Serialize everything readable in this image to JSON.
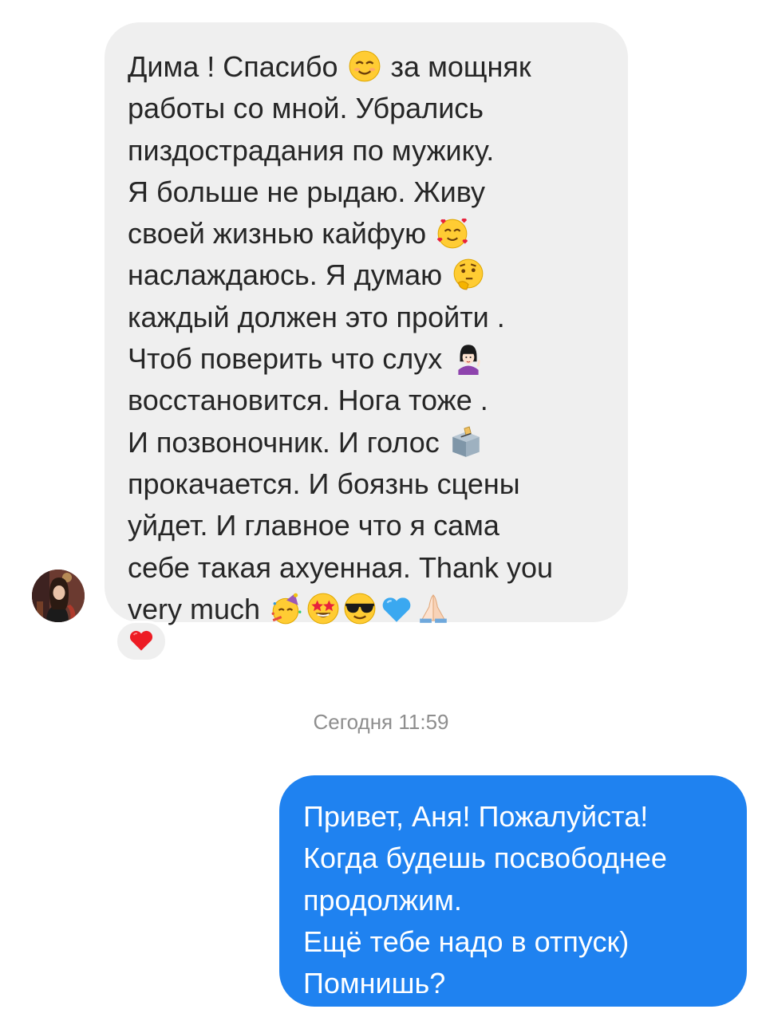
{
  "incoming_message": {
    "lines": [
      {
        "pre": "Дима ! Спасибо ",
        "emoji": "smiling-face-icon",
        "post": " за мощняк"
      },
      {
        "pre": "работы со мной. Убрались",
        "emoji": "",
        "post": ""
      },
      {
        "pre": "пиздострадания по мужику.",
        "emoji": "",
        "post": ""
      },
      {
        "pre": "Я больше не рыдаю. Живу",
        "emoji": "",
        "post": ""
      },
      {
        "pre": "своей жизнью кайфую ",
        "emoji": "smiling-face-with-hearts-icon",
        "post": ""
      },
      {
        "pre": "наслаждаюсь. Я думаю ",
        "emoji": "thinking-face-icon",
        "post": ""
      },
      {
        "pre": "каждый должен это пройти .",
        "emoji": "",
        "post": ""
      },
      {
        "pre": "Чтоб поверить что слух ",
        "emoji": "woman-tipping-hand-icon",
        "post": ""
      },
      {
        "pre": "восстановится. Нога тоже .",
        "emoji": "",
        "post": ""
      },
      {
        "pre": "И позвоночник. И голос ",
        "emoji": "ballot-box-icon",
        "post": ""
      },
      {
        "pre": "прокачается. И боязнь сцены",
        "emoji": "",
        "post": ""
      },
      {
        "pre": "уйдет. И главное что я сама",
        "emoji": "",
        "post": ""
      },
      {
        "pre": "себе такая ахуенная. Thank you",
        "emoji": "",
        "post": ""
      },
      {
        "pre": "very much ",
        "emoji": "",
        "post": ""
      }
    ],
    "last_line_emojis": [
      "partying-face-icon",
      "star-struck-icon",
      "smiling-face-with-sunglasses-icon",
      "blue-heart-icon",
      "folded-hands-icon"
    ]
  },
  "reaction": {
    "emoji": "red-heart-icon",
    "color": "#ed1c24"
  },
  "timestamp": "Сегодня 11:59",
  "outgoing_message": {
    "lines": [
      "Привет, Аня! Пожалуйста!",
      "Когда будешь посвободнее",
      "продолжим.",
      "Ещё тебе надо в отпуск)",
      "Помнишь?"
    ]
  },
  "colors": {
    "incoming_bubble": "#efefef",
    "outgoing_bubble": "#1f82f0",
    "incoming_text": "#262626",
    "outgoing_text": "#ffffff",
    "timestamp_text": "#8e8e8e"
  }
}
